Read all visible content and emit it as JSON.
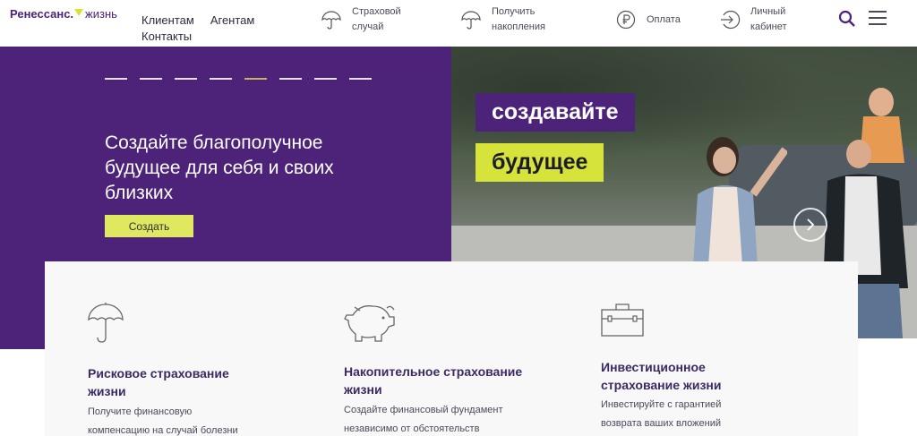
{
  "header": {
    "logo_main": "Ренессанс.",
    "logo_sub": "жизнь",
    "nav": [
      "Клиентам",
      "Агентам",
      "Контакты"
    ],
    "items": [
      {
        "label": "Страховой случай",
        "icon": "umbrella-icon"
      },
      {
        "label": "Получить накопления",
        "icon": "umbrella-icon"
      },
      {
        "label": "Оплата",
        "icon": "ruble-icon"
      },
      {
        "label": "Личный кабинет",
        "icon": "login-icon"
      }
    ]
  },
  "hero": {
    "slides_total": 8,
    "active_slide": 5,
    "title": "Создайте благополучное будущее для себя и своих близких",
    "button": "Создать",
    "tag1": "создавайте",
    "tag2": "будущее"
  },
  "cards": [
    {
      "icon": "umbrella-icon",
      "title": "Рисковое страхование жизни",
      "desc": "Получите финансовую компенсацию на случай болезни"
    },
    {
      "icon": "piggy-bank-icon",
      "title": "Накопительное страхование жизни",
      "desc": "Создайте финансовый фундамент независимо от обстоятельств"
    },
    {
      "icon": "briefcase-icon",
      "title": "Инвестиционное страхование жизни",
      "desc": "Инвестируйте с гарантией возврата ваших вложений"
    }
  ],
  "colors": {
    "brand": "#4d2279",
    "accent": "#dfe85f"
  }
}
